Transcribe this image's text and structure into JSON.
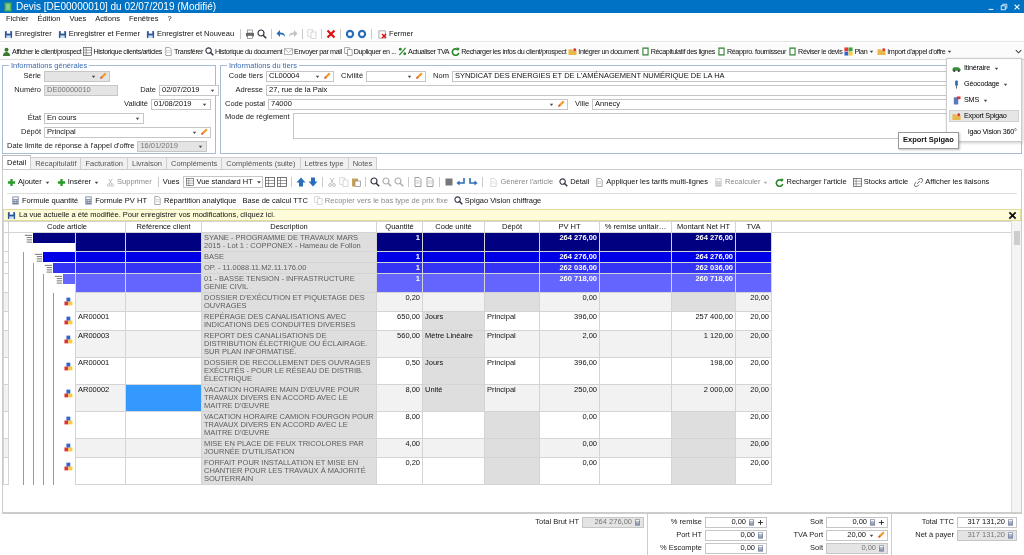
{
  "window": {
    "title": "Devis [DE00000010] du 02/07/2019 (Modifié)"
  },
  "menu": [
    {
      "label": "Fichier"
    },
    {
      "label": "Édition"
    },
    {
      "label": "Vues"
    },
    {
      "label": "Actions"
    },
    {
      "label": "Fenêtres"
    },
    {
      "label": "?"
    }
  ],
  "toolbar_main": [
    {
      "kind": "button",
      "label": "Enregistrer",
      "disabled": false
    },
    {
      "kind": "button",
      "label": "Enregistrer et Fermer",
      "disabled": false
    },
    {
      "kind": "button",
      "label": "Enregistrer et Nouveau",
      "disabled": false
    },
    {
      "kind": "separator"
    },
    {
      "kind": "icon",
      "disabled": false
    },
    {
      "kind": "icon",
      "disabled": false
    },
    {
      "kind": "separator"
    },
    {
      "kind": "icon",
      "disabled": false
    },
    {
      "kind": "icon",
      "disabled": true
    },
    {
      "kind": "separator"
    },
    {
      "kind": "icon",
      "disabled": true
    },
    {
      "kind": "separator"
    },
    {
      "kind": "icon",
      "disabled": false
    },
    {
      "kind": "separator"
    },
    {
      "kind": "icon",
      "disabled": false
    },
    {
      "kind": "icon",
      "disabled": false
    },
    {
      "kind": "separator"
    },
    {
      "kind": "button",
      "label": "Fermer",
      "disabled": false
    }
  ],
  "toolbar_secondary": [
    {
      "kind": "button",
      "label": "Afficher le client/prospect",
      "dropdown": false
    },
    {
      "kind": "button",
      "label": "Historique clients/articles",
      "dropdown": false
    },
    {
      "kind": "button",
      "label": "Transférer",
      "dropdown": false
    },
    {
      "kind": "button",
      "label": "Historique du document",
      "dropdown": false
    },
    {
      "kind": "button",
      "label": "Envoyer par mail",
      "dropdown": false
    },
    {
      "kind": "button",
      "label": "Dupliquer en ...",
      "dropdown": false
    },
    {
      "kind": "button",
      "label": "Actualiser TVA",
      "dropdown": false
    },
    {
      "kind": "button",
      "label": "Recharger les infos du client/prospect",
      "dropdown": false
    },
    {
      "kind": "button",
      "label": "Intégrer un document",
      "dropdown": false
    },
    {
      "kind": "button",
      "label": "Récapitulatif des lignes",
      "dropdown": false
    },
    {
      "kind": "button",
      "label": "Réappro. fournisseur",
      "dropdown": false
    },
    {
      "kind": "button",
      "label": "Réviser le devis",
      "dropdown": false
    },
    {
      "kind": "button",
      "label": "Plan",
      "dropdown": true
    },
    {
      "kind": "button",
      "label": "Import d'appel d'offre",
      "dropdown": true
    },
    {
      "kind": "overflow"
    }
  ],
  "overflow_menu": [
    {
      "label": "Itinéraire",
      "dropdown": true,
      "selected": false
    },
    {
      "label": "Géocodage",
      "dropdown": true,
      "selected": false
    },
    {
      "label": "SMS",
      "dropdown": true,
      "selected": false
    },
    {
      "label": "Export Spigao",
      "dropdown": false,
      "selected": true
    },
    {
      "label": "igao Vision 360°",
      "dropdown": false,
      "selected": false
    }
  ],
  "tooltip": {
    "text": "Export Spigao"
  },
  "general": {
    "title": "Informations générales",
    "fields": [
      {
        "label": "Série",
        "kind": "combo_edit",
        "disabled": true
      },
      {
        "label": "Numéro",
        "kind": "text",
        "value": "DE00000010",
        "disabled": true
      },
      {
        "label": "Date",
        "kind": "combo",
        "value": "02/07/2019",
        "disabled": false
      },
      {
        "label": "Validité",
        "kind": "combo",
        "value": "01/08/2019",
        "disabled": false
      },
      {
        "label": "État",
        "kind": "combo",
        "value": "En cours",
        "disabled": false
      },
      {
        "label": "Dépôt",
        "kind": "combo_edit",
        "value": "Principal",
        "disabled": false
      },
      {
        "label": "Date limite de réponse à l'appel d'offre",
        "kind": "combo",
        "value": "16/01/2019",
        "disabled": true
      }
    ]
  },
  "third_party": {
    "title": "Informations du tiers",
    "fields": [
      {
        "label": "Code tiers",
        "kind": "combo_edit",
        "value": "CL00004"
      },
      {
        "label": "Civilité",
        "kind": "combo_edit"
      },
      {
        "label": "Nom",
        "kind": "text",
        "value": "SYNDICAT DES ENERGIES ET DE L'AMÉNAGEMENT NUMÉRIQUE DE LA HA"
      },
      {
        "label": "Adresse",
        "kind": "text",
        "value": "27, rue de la Paix"
      },
      {
        "label": "Code postal",
        "kind": "combo_edit",
        "value": "74000"
      },
      {
        "label": "Ville",
        "kind": "text",
        "value": "Annecy"
      },
      {
        "label": "Mode de règlement",
        "kind": "memo"
      }
    ]
  },
  "tabs": [
    {
      "label": "Détail",
      "selected": true
    },
    {
      "label": "Récapitulatif",
      "selected": false
    },
    {
      "label": "Facturation",
      "selected": false
    },
    {
      "label": "Livraison",
      "selected": false
    },
    {
      "label": "Compléments",
      "selected": false
    },
    {
      "label": "Compléments (suite)",
      "selected": false
    },
    {
      "label": "Lettres type",
      "selected": false
    },
    {
      "label": "Notes",
      "selected": false
    }
  ],
  "detail_toolbar": [
    {
      "kind": "button",
      "label": "Ajouter",
      "dropdown": true,
      "disabled": false
    },
    {
      "kind": "button",
      "label": "Insérer",
      "dropdown": true,
      "disabled": false
    },
    {
      "kind": "button",
      "label": "Supprimer",
      "dropdown": false,
      "disabled": true
    },
    {
      "kind": "separator"
    },
    {
      "kind": "label",
      "label": "Vues"
    },
    {
      "kind": "combo",
      "value": "Vue standard HT"
    },
    {
      "kind": "icon",
      "disabled": false
    },
    {
      "kind": "icon",
      "disabled": false
    },
    {
      "kind": "separator"
    },
    {
      "kind": "icon",
      "disabled": false
    },
    {
      "kind": "icon",
      "disabled": false
    },
    {
      "kind": "separator"
    },
    {
      "kind": "icon",
      "disabled": true
    },
    {
      "kind": "icon",
      "disabled": true
    },
    {
      "kind": "icon",
      "disabled": false
    },
    {
      "kind": "separator"
    },
    {
      "kind": "icon",
      "disabled": false
    },
    {
      "kind": "icon",
      "disabled": true
    },
    {
      "kind": "icon",
      "disabled": true
    },
    {
      "kind": "separator"
    },
    {
      "kind": "icon",
      "disabled": false
    },
    {
      "kind": "icon",
      "disabled": false
    },
    {
      "kind": "separator"
    },
    {
      "kind": "icon",
      "disabled": false
    },
    {
      "kind": "icon",
      "disabled": false
    },
    {
      "kind": "icon",
      "disabled": false
    },
    {
      "kind": "separator"
    },
    {
      "kind": "button",
      "label": "Générer l'article",
      "dropdown": false,
      "disabled": true
    },
    {
      "kind": "button",
      "label": "Détail",
      "dropdown": false,
      "disabled": false
    },
    {
      "kind": "button",
      "label": "Appliquer les tarifs multi-lignes",
      "dropdown": false,
      "disabled": false
    },
    {
      "kind": "button",
      "label": "Recalculer",
      "dropdown": true,
      "disabled": true
    },
    {
      "kind": "button",
      "label": "Recharger l'article",
      "dropdown": false,
      "disabled": false
    },
    {
      "kind": "button",
      "label": "Stocks article",
      "dropdown": false,
      "disabled": false
    },
    {
      "kind": "button",
      "label": "Afficher les liaisons",
      "dropdown": false,
      "disabled": false
    }
  ],
  "detail_toolbar_2": [
    {
      "label": "Formule quantité",
      "disabled": false
    },
    {
      "label": "Formule PV HT",
      "disabled": false
    },
    {
      "label": "Répartition analytique",
      "disabled": false
    },
    {
      "label": "Base de calcul TTC",
      "disabled": false
    },
    {
      "label": "Recopier vers le bas type de prix fixe",
      "disabled": true
    },
    {
      "label": "Spigao Vision chiffrage",
      "disabled": false
    }
  ],
  "info_bar": {
    "text": "La vue actuelle a été modifiée. Pour enregistrer vos modifications, cliquez ici."
  },
  "table": {
    "columns": [
      "Code article",
      "Référence client",
      "Description",
      "Quantité",
      "Code unité",
      "Dépôt",
      "PV HT",
      "% remise unitair…",
      "Montant Net HT",
      "TVA"
    ],
    "rows": [
      {
        "kind": "group",
        "description": "SYANE - PROGRAMME DE TRAVAUX MARS 2015  - Lot 1 : COPPONEX - Hameau de Follon",
        "quantity": "1",
        "pv_ht": "264 276,00",
        "amount": "264 276,00",
        "selected": false,
        "children": [
          {
            "kind": "group",
            "description": "BASE",
            "quantity": "1",
            "pv_ht": "264 276,00",
            "amount": "264 276,00",
            "selected": false,
            "children": [
              {
                "kind": "group",
                "description": "OP. - 11.0088.11.M2.11.176.00",
                "quantity": "1",
                "pv_ht": "262 036,00",
                "amount": "262 036,00",
                "selected": false,
                "children": [
                  {
                    "kind": "group",
                    "description": "01 - BASSE TENSION - INFRASTRUCTURE GENIE CIVIL",
                    "quantity": "1",
                    "pv_ht": "260 718,00",
                    "amount": "260 718,00",
                    "selected": false,
                    "children": [
                      {
                        "kind": "item",
                        "description": "DOSSIER D'EXÉCUTION ET PIQUETAGE DES OUVRAGES",
                        "quantity": "0,20",
                        "pv_ht": "0,00",
                        "vat": "20,00",
                        "selected": false
                      },
                      {
                        "kind": "item",
                        "code": "AR00001",
                        "description": "REPÉRAGE DES CANALISATIONS AVEC INDICATIONS DES CONDUITES DIVERSES",
                        "quantity": "650,00",
                        "unit": "Jours",
                        "depot": "Principal",
                        "pv_ht": "396,00",
                        "amount": "257 400,00",
                        "vat": "20,00",
                        "selected": false
                      },
                      {
                        "kind": "item",
                        "code": "AR00003",
                        "description": "REPORT DES CANALISATIONS DE DISTRIBUTION ÉLECTRIQUE OU ÉCLAIRAGE. SUR PLAN INFORMATISÉ.",
                        "quantity": "560,00",
                        "unit": "Mètre Linéaire",
                        "depot": "Principal",
                        "pv_ht": "2,00",
                        "amount": "1 120,00",
                        "vat": "20,00",
                        "selected": false
                      },
                      {
                        "kind": "item",
                        "code": "AR00001",
                        "description": "DOSSIER DE RECOLLEMENT DES OUVRAGES EXÉCUTÉS - POUR LE RÉSEAU DE DISTRIB. ÉLECTRIQUE",
                        "quantity": "0,50",
                        "unit": "Jours",
                        "depot": "Principal",
                        "pv_ht": "396,00",
                        "amount": "198,00",
                        "vat": "20,00",
                        "selected": false
                      },
                      {
                        "kind": "item",
                        "code": "AR00002",
                        "description": "VACATION HORAIRE MAIN D'ŒUVRE POUR TRAVAUX DIVERS EN ACCORD AVEC LE MAITRE D'ŒUVRE",
                        "quantity": "8,00",
                        "unit": "Unité",
                        "depot": "Principal",
                        "pv_ht": "250,00",
                        "amount": "2 000,00",
                        "vat": "20,00",
                        "selected": true
                      },
                      {
                        "kind": "item",
                        "description": "VACATION HORAIRE CAMION FOURGON POUR TRAVAUX DIVERS EN ACCORD AVEC LE MAITRE D'ŒUVRE",
                        "quantity": "8,00",
                        "pv_ht": "0,00",
                        "vat": "20,00",
                        "selected": false
                      },
                      {
                        "kind": "item",
                        "description": "MISE EN PLACE DE FEUX TRICOLORES PAR JOURNÉE D'UTILISATION",
                        "quantity": "4,00",
                        "pv_ht": "0,00",
                        "vat": "20,00",
                        "selected": false
                      },
                      {
                        "kind": "item",
                        "description": "FORFAIT POUR INSTALLATION ET MISE EN CHANTIER POUR LES TRAVAUX À MAJORITÉ SOUTERRAIN",
                        "quantity": "0,20",
                        "pv_ht": "0,00",
                        "vat": "20,00",
                        "selected": false
                      }
                    ]
                  }
                ]
              }
            ]
          }
        ]
      }
    ]
  },
  "footer": {
    "columns": [
      [
        {
          "label": "Total Brut HT",
          "value": "264 276,00",
          "kind": "calc",
          "disabled": true
        }
      ],
      [
        {
          "label": "% remise",
          "value": "0,00",
          "kind": "calc_add",
          "disabled": false
        },
        {
          "label": "Port HT",
          "value": "0,00",
          "kind": "calc",
          "disabled": false
        },
        {
          "label": "% Escompte",
          "value": "0,00",
          "kind": "calc",
          "disabled": false
        }
      ],
      [
        {
          "label": "Soit",
          "value": "0,00",
          "kind": "calc_add",
          "disabled": false
        },
        {
          "label": "TVA Port",
          "value": "20,00",
          "kind": "combo_edit",
          "disabled": false
        },
        {
          "label": "Soit",
          "value": "0,00",
          "kind": "calc",
          "disabled": true
        }
      ],
      [
        {
          "label": "Total TTC",
          "value": "317 131,20",
          "kind": "calc",
          "disabled": false
        },
        {
          "label": "Net à payer",
          "value": "317 131,20",
          "kind": "calc",
          "disabled": true
        }
      ]
    ]
  }
}
